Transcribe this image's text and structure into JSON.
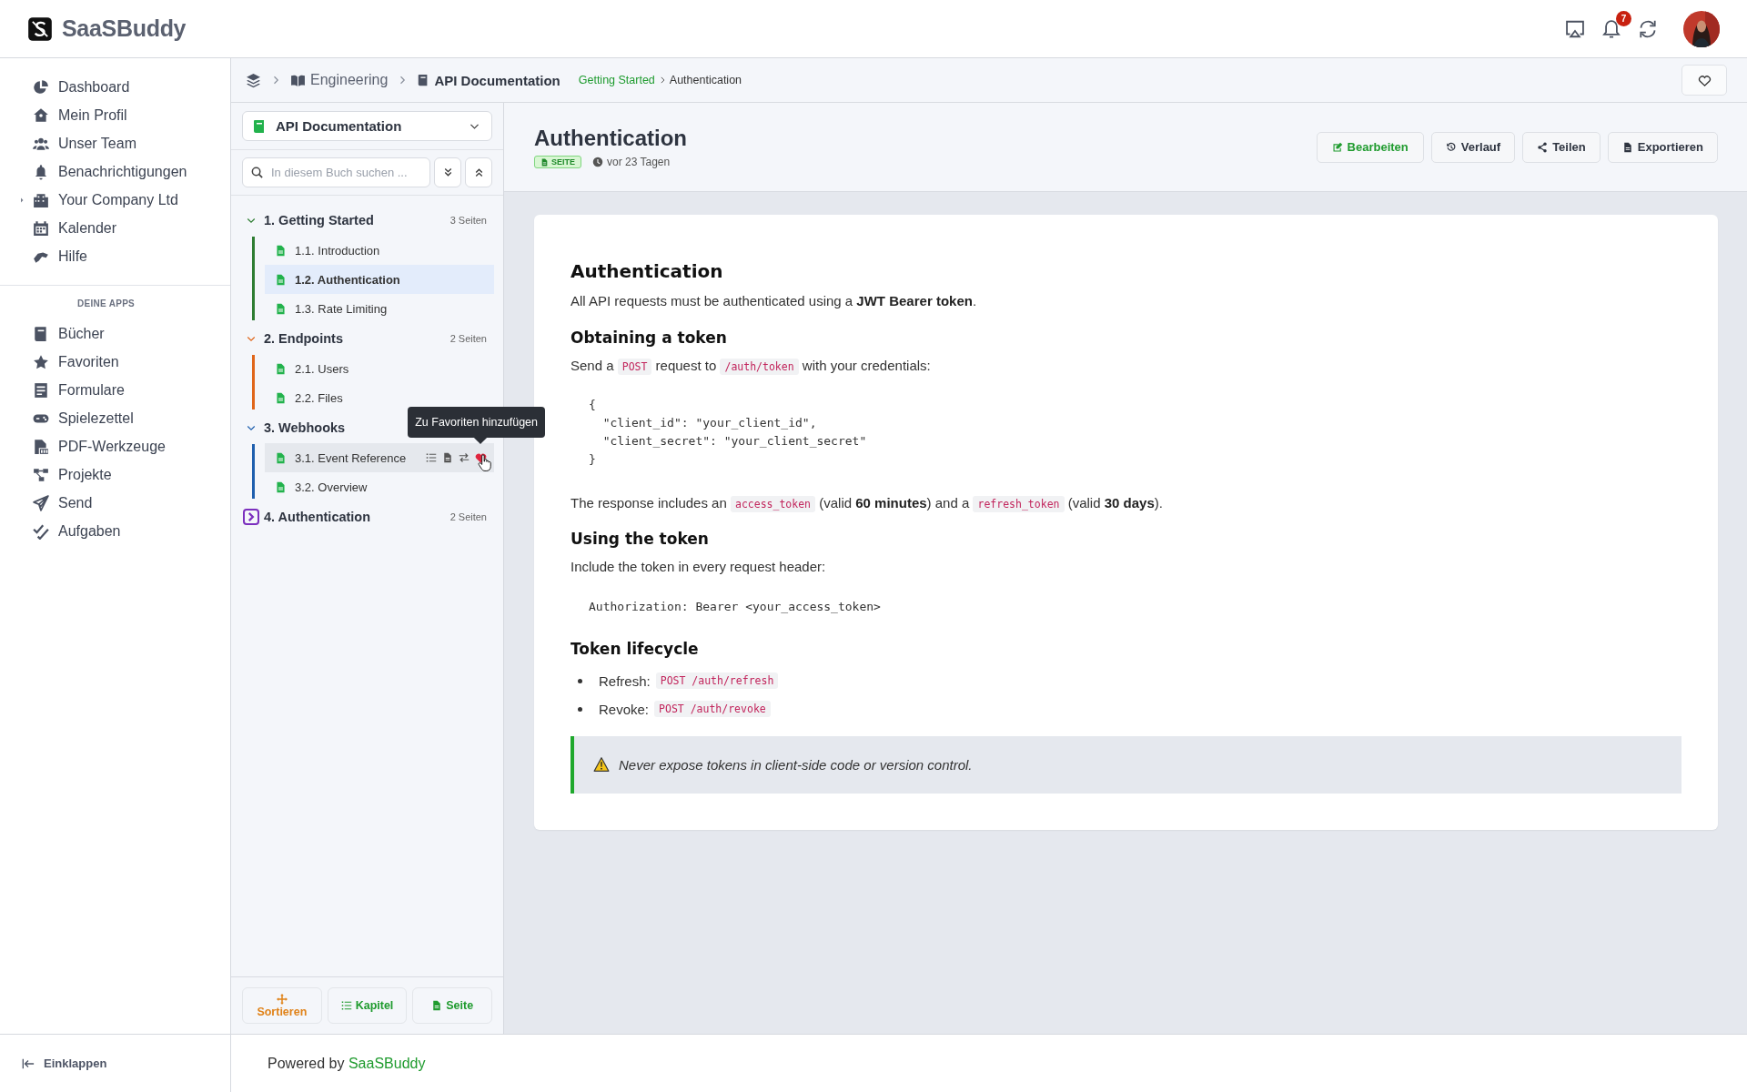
{
  "brand": {
    "name": "SaaSBuddy"
  },
  "header": {
    "notification_count": "7"
  },
  "nav": {
    "items": [
      {
        "label": "Dashboard",
        "kind": "link"
      },
      {
        "label": "Mein Profil",
        "kind": "link"
      },
      {
        "label": "Unser Team",
        "kind": "link"
      },
      {
        "label": "Benachrichtigungen",
        "kind": "link"
      },
      {
        "label": "Your Company Ltd",
        "kind": "group",
        "expanded": false
      },
      {
        "label": "Kalender",
        "kind": "link"
      },
      {
        "label": "Hilfe",
        "kind": "link"
      }
    ],
    "section_title": "DEINE APPS",
    "apps": [
      {
        "label": "Bücher"
      },
      {
        "label": "Favoriten"
      },
      {
        "label": "Formulare"
      },
      {
        "label": "Spielezettel"
      },
      {
        "label": "PDF-Werkzeuge"
      },
      {
        "label": "Projekte"
      },
      {
        "label": "Send"
      },
      {
        "label": "Aufgaben"
      }
    ]
  },
  "collapse": {
    "label": "Einklappen"
  },
  "breadcrumb": {
    "items": [
      {
        "label": "Engineering"
      },
      {
        "label": "API Documentation"
      }
    ],
    "path": [
      {
        "label": "Getting Started",
        "kind": "link"
      },
      {
        "label": "Authentication",
        "kind": "current"
      }
    ]
  },
  "book_panel": {
    "book": "API Documentation",
    "search": {
      "placeholder": "In diesem Buch suchen ..."
    },
    "chapters": [
      {
        "title": "1. Getting Started",
        "count": "3 Seiten",
        "color": "#2e7d32",
        "expanded": true,
        "pages": [
          {
            "title": "1.1. Introduction",
            "selected": false,
            "hovered": false
          },
          {
            "title": "1.2. Authentication",
            "selected": true,
            "hovered": false
          },
          {
            "title": "1.3. Rate Limiting",
            "selected": false,
            "hovered": false
          }
        ]
      },
      {
        "title": "2. Endpoints",
        "count": "2 Seiten",
        "color": "#e0661a",
        "expanded": true,
        "pages": [
          {
            "title": "2.1. Users",
            "selected": false,
            "hovered": false
          },
          {
            "title": "2.2. Files",
            "selected": false,
            "hovered": false
          }
        ]
      },
      {
        "title": "3. Webhooks",
        "color": "#1f5fae",
        "expanded": true,
        "pages": [
          {
            "title": "3.1. Event Reference",
            "selected": false,
            "hovered": true
          },
          {
            "title": "3.2. Overview",
            "selected": false,
            "hovered": false
          }
        ]
      },
      {
        "title": "4. Authentication",
        "count": "2 Seiten",
        "color": "#7b2fbe",
        "expanded": false
      }
    ],
    "tooltip": "Zu Favoriten hinzufügen",
    "buttons": [
      {
        "label": "Sortieren",
        "kind": "sort"
      },
      {
        "label": "Kapitel",
        "kind": "chapter"
      },
      {
        "label": "Seite",
        "kind": "page"
      }
    ]
  },
  "page": {
    "title": "Authentication",
    "badge": "SEITE",
    "updated": "vor 23 Tagen",
    "actions": [
      {
        "label": "Bearbeiten",
        "kind": "edit"
      },
      {
        "label": "Verlauf",
        "kind": "history"
      },
      {
        "label": "Teilen",
        "kind": "share"
      },
      {
        "label": "Exportieren",
        "kind": "export"
      }
    ],
    "blocks": [
      {
        "kind": "h1",
        "text": "Authentication"
      },
      {
        "kind": "p",
        "parts": [
          {
            "kind": "text",
            "text": "All API requests must be authenticated using a **JWT Bearer token**."
          }
        ]
      },
      {
        "kind": "h2",
        "text": "Obtaining a token"
      },
      {
        "kind": "p",
        "parts": [
          {
            "kind": "text",
            "text": "Send a"
          },
          {
            "kind": "code",
            "text": "POST"
          },
          {
            "kind": "text",
            "text": "request to"
          },
          {
            "kind": "code",
            "text": "/auth/token"
          },
          {
            "kind": "text",
            "text": "with your credentials:"
          }
        ]
      },
      {
        "kind": "code",
        "text": "{\n  \"client_id\": \"your_client_id\",\n  \"client_secret\": \"your_client_secret\"\n}"
      },
      {
        "kind": "p",
        "parts": [
          {
            "kind": "text",
            "text": "The response includes an"
          },
          {
            "kind": "code",
            "text": "access_token"
          },
          {
            "kind": "text",
            "text": "(valid **60 minutes**) and a"
          },
          {
            "kind": "code",
            "text": "refresh_token"
          },
          {
            "kind": "text",
            "text": "(valid **30 days**)."
          }
        ]
      },
      {
        "kind": "h2",
        "text": "Using the token"
      },
      {
        "kind": "p",
        "parts": [
          {
            "kind": "text",
            "text": "Include the token in every request header:"
          }
        ]
      },
      {
        "kind": "code",
        "text": "Authorization: Bearer <your_access_token>"
      },
      {
        "kind": "h2",
        "text": "Token lifecycle"
      },
      {
        "kind": "list",
        "items": [
          {
            "label": "Refresh:",
            "code": "POST /auth/refresh"
          },
          {
            "label": "Revoke:",
            "code": "POST /auth/revoke"
          }
        ]
      },
      {
        "kind": "note",
        "text": "Never expose tokens in client-side code or version control."
      }
    ]
  },
  "footer": {
    "text": "Powered by",
    "link": "SaaSBuddy"
  }
}
